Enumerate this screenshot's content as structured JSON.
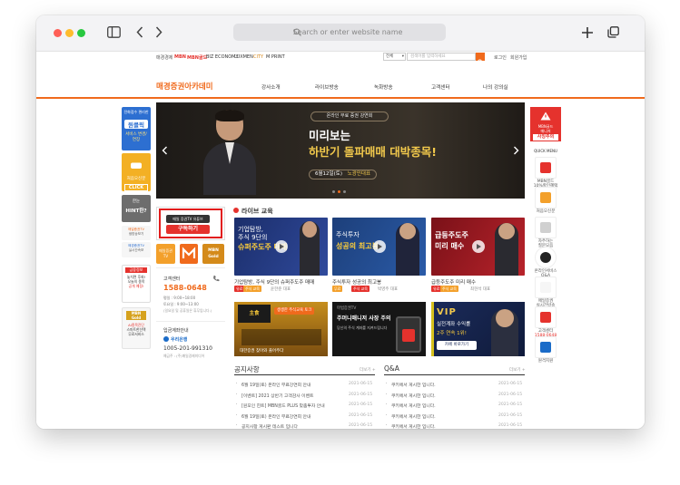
{
  "browser": {
    "address_placeholder": "Search or enter website name"
  },
  "topbar": {
    "sites": [
      "매경경제",
      "MBN",
      "MBN골드",
      "BIZ ECONOMY",
      "LUXMEN",
      "CITY",
      "M PRINT"
    ],
    "search_option": "전체",
    "search_placeholder": "검색어를 입력하세요",
    "login": "로그인",
    "join": "회원가입"
  },
  "site": {
    "logo": "매경증권아카데미",
    "nav": [
      "강사소개",
      "라이브방송",
      "녹화방송",
      "고객센터",
      "나의 강의실"
    ]
  },
  "left_ads": {
    "ad1_top": "전화접수 편리한",
    "ad1_main": "원클릭",
    "ad1_sub": "서비스 변경/연장",
    "ad2_top": "처음오신분",
    "ad2_btn": "CLICK",
    "ad3_top": "한눈",
    "ad3_main": "HINT한?",
    "ad4_top": "매일증권TV",
    "ad4_sub": "생방송보기",
    "ad5_top": "매경증권TV",
    "ad5_sub": "실시간속보",
    "ad6_top": "금융정보",
    "ad6_lines": [
      "놓치면 후회!",
      "오늘의 종목",
      "공개 예정!"
    ],
    "ad7_top": "MBN Gold",
    "ad7_lines": [
      "AI종목진단",
      "스마트한선택",
      "무료서비스"
    ]
  },
  "banner": {
    "tagline": "온라인 무료 증권 강연회",
    "title1": "미리보는",
    "title2": "하반기 돌파매매 대박종목!",
    "date": "6월12일(토)",
    "speaker": "노광민대표"
  },
  "youtube": {
    "top": "매일 증권TV 유튜브",
    "button": "구독하기"
  },
  "shortcuts": {
    "label1": "매일증권 TV",
    "label2": "MBN Gold"
  },
  "support": {
    "title": "고객센터",
    "phone": "1588-0648",
    "hours1": "평일 : 9:00~18:00",
    "hours2": "토요일 : 9:00~13:00",
    "note": "(일요일 및 공휴일은 휴무입니다.)"
  },
  "bank": {
    "title": "입금계좌안내",
    "bank_name": "우리은행",
    "account": "1005-201-991310",
    "holder": "예금주 : (주)매일경제미디어"
  },
  "live": {
    "title": "라이브 교육",
    "items": [
      {
        "caption": "기업탐방, 주식 9단의 슈퍼주도주 매매",
        "tag1": "유료",
        "tag2": "주식 교육",
        "teacher": "윤한준 대표",
        "t1": "기업탐방,",
        "t2": "주식 9단의",
        "t3": "슈퍼주도주 매매"
      },
      {
        "caption": "주식투자 성공의 최고봉",
        "tag1": "무료",
        "tag2": "주식 교육",
        "teacher": "박영주 대표",
        "t1": "주식투자",
        "t2": "성공의 최고봉"
      },
      {
        "caption": "급등주도주 미리 매수",
        "tag1": "유료",
        "tag2": "주식 교육",
        "teacher": "최현석 대표",
        "t1": "급등주도주",
        "t2": "미리 매수"
      }
    ]
  },
  "promos": {
    "p1": {
      "top": "생생한 주식교육 토크",
      "main": "대한증권 찾아와 풀어주다"
    },
    "p2": {
      "top": "마법증권TV",
      "main": "주머니매니저 사장 주의",
      "sub": "당신의 주식 계좌를 지켜드립니다"
    },
    "p3": {
      "title": "VIP",
      "sub1": "실전계좌 수익률",
      "sub2": "2주 연속 1위!",
      "btn": "카페 바로가기"
    }
  },
  "notices": {
    "title": "공지사항",
    "more": "더보기 +",
    "items": [
      {
        "text": "6월 19일(토) 온라인 무료강연회 안내",
        "date": "2021-06-15"
      },
      {
        "text": "[이벤트] 2021 상반기 고객감사 이벤트",
        "date": "2021-06-15"
      },
      {
        "text": "[원포인 힌트] MBN골드 PLUS 맞춤투자 안내",
        "date": "2021-06-15"
      },
      {
        "text": "6월 19일(토) 온라인 무료강연회 안내",
        "date": "2021-06-15"
      },
      {
        "text": "공지사항 게시판 테스트 입니다",
        "date": "2021-06-15"
      }
    ]
  },
  "qna": {
    "title": "Q&A",
    "more": "더보기 +",
    "items": [
      {
        "text": "쿠키에서 게시한 입니다.",
        "date": "2021-06-15"
      },
      {
        "text": "쿠키에서 게시한 입니다.",
        "date": "2021-06-15"
      },
      {
        "text": "쿠키에서 게시한 입니다.",
        "date": "2021-06-15"
      },
      {
        "text": "쿠키에서 게시한 입니다.",
        "date": "2021-06-15"
      },
      {
        "text": "쿠키에서 게시한 입니다.",
        "date": "2021-06-15"
      }
    ]
  },
  "right_ad": {
    "line1": "MBN골드",
    "line2": "매니저",
    "line3": "사칭주의"
  },
  "quick_menu": {
    "title": "QUICK MENU",
    "items": [
      {
        "name": "MBN골드",
        "sub": "10%할인혜택"
      },
      {
        "name": "처음오신분",
        "sub": ""
      },
      {
        "name": "자주하는",
        "sub": "질문모음"
      },
      {
        "name": "온라인서비스",
        "sub": "Q&A"
      },
      {
        "name": "매일증권",
        "sub": "실시간방송"
      },
      {
        "name": "고객센터",
        "sub": "1588-0648"
      },
      {
        "name": "원격지원",
        "sub": ""
      }
    ]
  },
  "colors": {
    "accent": "#f06a1c",
    "red": "#d32a2a",
    "banner_text": "#f2c94c"
  }
}
